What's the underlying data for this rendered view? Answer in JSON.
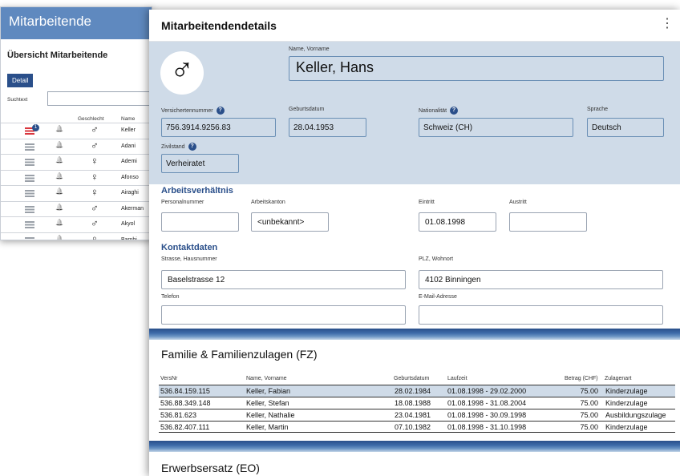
{
  "list": {
    "title": "Mitarbeitende",
    "subtitle": "Übersicht Mitarbeitende",
    "detail_button": "Detail",
    "search_label": "Suchtext",
    "col_sex": "Geschlecht",
    "col_name": "Name",
    "badge": "1",
    "rows": [
      {
        "sex": "♂",
        "name": "Keller"
      },
      {
        "sex": "♂",
        "name": "Adani"
      },
      {
        "sex": "♀",
        "name": "Ademi"
      },
      {
        "sex": "♀",
        "name": "Afonso"
      },
      {
        "sex": "♀",
        "name": "Airaghi"
      },
      {
        "sex": "♂",
        "name": "Akerman"
      },
      {
        "sex": "♂",
        "name": "Akyol"
      },
      {
        "sex": "♀",
        "name": "Bambi"
      }
    ]
  },
  "modal": {
    "title": "Mitarbeitendendetails",
    "menu_icon": "kebab-icon",
    "avatar_symbol": "♂",
    "name_label": "Name, Vorname",
    "name_value": "Keller, Hans",
    "ahv_label": "Versichertennummer",
    "ahv_value": "756.3914.9256.83",
    "birth_label": "Geburtsdatum",
    "birth_value": "28.04.1953",
    "nat_label": "Nationalität",
    "nat_value": "Schweiz (CH)",
    "lang_label": "Sprache",
    "lang_value": "Deutsch",
    "civil_label": "Zivilstand",
    "civil_value": "Verheiratet",
    "info_glyph": "?"
  },
  "employment": {
    "title": "Arbeitsverhältnis",
    "pers_label": "Personalnummer",
    "pers_value": "",
    "canton_label": "Arbeitskanton",
    "canton_value": "<unbekannt>",
    "entry_label": "Eintritt",
    "entry_value": "01.08.1998",
    "exit_label": "Austritt",
    "exit_value": ""
  },
  "contact": {
    "title": "Kontaktdaten",
    "street_label": "Strasse, Hausnummer",
    "street_value": "Baselstrasse 12",
    "city_label": "PLZ, Wohnort",
    "city_value": "4102 Binningen",
    "phone_label": "Telefon",
    "phone_value": "",
    "email_label": "E-Mail-Adresse",
    "email_value": ""
  },
  "family": {
    "title": "Familie & Familienzulagen (FZ)",
    "headers": {
      "vers": "VersNr",
      "name": "Name, Vorname",
      "birth": "Geburtsdatum",
      "period": "Laufzeit",
      "amount": "Betrag (CHF)",
      "type": "Zulagenart"
    },
    "rows": [
      {
        "vers": "536.84.159.115",
        "name": "Keller, Fabian",
        "birth": "28.02.1984",
        "period": "01.08.1998 - 29.02.2000",
        "amount": "75.00",
        "type": "Kinderzulage"
      },
      {
        "vers": "536.88.349.148",
        "name": "Keller, Stefan",
        "birth": "18.08.1988",
        "period": "01.08.1998 - 31.08.2004",
        "amount": "75.00",
        "type": "Kinderzulage"
      },
      {
        "vers": "536.81.623",
        "name": "Keller, Nathalie",
        "birth": "23.04.1981",
        "period": "01.08.1998 - 30.09.1998",
        "amount": "75.00",
        "type": "Ausbildungszulage"
      },
      {
        "vers": "536.82.407.111",
        "name": "Keller, Martin",
        "birth": "07.10.1982",
        "period": "01.08.1998 - 31.10.1998",
        "amount": "75.00",
        "type": "Kinderzulage"
      }
    ]
  },
  "eo": {
    "title": "Erwerbsersatz (EO)"
  }
}
